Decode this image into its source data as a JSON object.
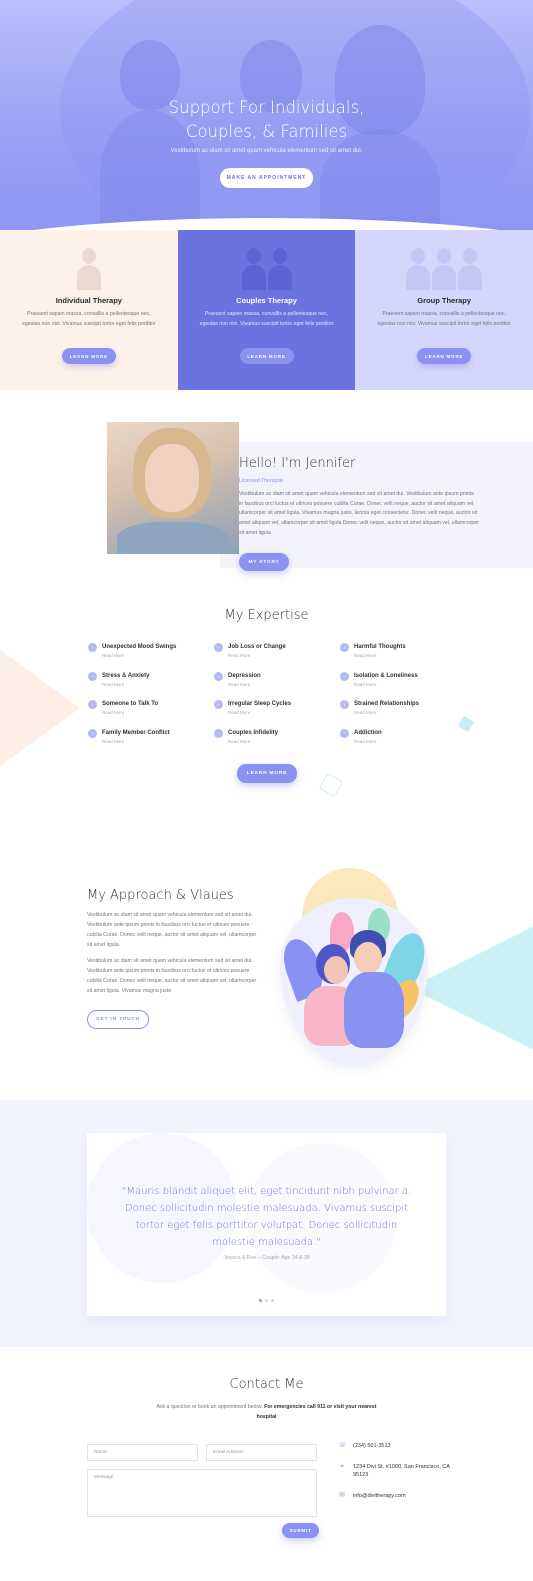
{
  "hero": {
    "title_line1": "Support For Individuals,",
    "title_line2": "Couples, & Families",
    "subtitle": "Vestibulum ac diam sit amet quam vehicula elementum sed sit amet dui.",
    "button": "MAKE AN APPOINTMENT"
  },
  "services": [
    {
      "title": "Individual Therapy",
      "text": "Praesent sapien massa, convallis a pellentesque nec, egestas non nisi. Vivamus suscipit tortor eget felis porttitor",
      "button": "LEARN MORE"
    },
    {
      "title": "Couples Therapy",
      "text": "Praesent sapien massa, convallis a pellentesque nec, egestas non nisi. Vivamus suscipit tortor eget felis porttitor",
      "button": "LEARN MORE"
    },
    {
      "title": "Group Therapy",
      "text": "Praesent sapien massa, convallis a pellentesque nec, egestas non nisi. Vivamus suscipit tortor eget felis porttitor",
      "button": "LEARN MORE"
    }
  ],
  "about": {
    "title": "Hello! I'm Jennifer",
    "role": "Licensed Therapist",
    "bio": "Vestibulum ac diam sit amet quam vehicula elementum sed sit amet dui. Vestibulum ante ipsum primis in faucibus orci luctus et ultrices posuere cubilia Curae. Donec velit neque, auctor sit amet aliquam vel, ullamcorper sit amet ligula. Vivamus magna justo, lacinia eget consectetur. Donec velit neque, auctor sit amet aliquam vel, ullamcorper sit amet ligula Donec velit neque, auctor sit amet aliquam vel, ullamcorper sit amet ligula",
    "button": "MY STORY"
  },
  "expertise": {
    "title": "My Expertise",
    "read_more": "Read More",
    "items": [
      {
        "num": "1",
        "label": "Unexpected Mood Swings"
      },
      {
        "num": "5",
        "label": "Job Loss or Change"
      },
      {
        "num": "9",
        "label": "Harmful Thoughts"
      },
      {
        "num": "2",
        "label": "Stress & Anxiety"
      },
      {
        "num": "6",
        "label": "Depression"
      },
      {
        "num": "10",
        "label": "Isolation & Loneliness"
      },
      {
        "num": "3",
        "label": "Someone to Talk To"
      },
      {
        "num": "7",
        "label": "Irregular Sleep Cycles"
      },
      {
        "num": "11",
        "label": "Strained Relationships"
      },
      {
        "num": "4",
        "label": "Family Member Conflict"
      },
      {
        "num": "8",
        "label": "Couples Infidelity"
      },
      {
        "num": "12",
        "label": "Addiction"
      }
    ],
    "button": "LEARN MORE"
  },
  "approach": {
    "title": "My Approach & Vlaues",
    "p1": "Vestibulum ac diam sit amet quam vehicula elementum sed sit amet dui. Vestibulum ante ipsum primis in faucibus orci luctus et ultrices posuere cubilia Curae. Donec velit neque, auctor sit amet aliquam vel, ullamcorper sit amet ligula.",
    "p2": "Vestibulum ac diam sit amet quam vehicula elementum sed sit amet dui. Vestibulum ante ipsum primis in faucibus orci luctus et ultrices posuere cubilia Curae. Donec velit neque, auctor sit amet aliquam vel, ullamcorper sit amet ligula. Vivamus magna justo",
    "button": "GET IN TOUCH"
  },
  "testimonial": {
    "quote": "\"Mauris blandit aliquet elit, eget tincidunt nibh pulvinar a. Donec sollicitudin molestie malesuada. Vivamus suscipit tortor eget felis porttitor volutpat. Donec sollicitudin molestie malesuada.\"",
    "author": "Jessica & Ron – Couple: Age 34 & 38"
  },
  "contact": {
    "title": "Contact Me",
    "intro_plain": "Ask a question or book an appointment below.",
    "intro_bold": "For emergencies call 911 or visit your nearest hospital",
    "name_placeholder": "Name",
    "email_placeholder": "Email Address",
    "message_placeholder": "Message",
    "submit": "SUBMIT",
    "phone": "(234) 501-3513",
    "address": "1234 Divi St. #1000, San Francisco, CA 95123",
    "email": "info@divitherapy.com"
  },
  "colors": {
    "accent": "#8a92f1",
    "primary": "#6b73e0",
    "peach": "#fdf1ea",
    "lavender": "#d4d6fb"
  },
  "icons": {
    "phone": "phone-icon",
    "location": "location-pin-icon",
    "email": "envelope-icon"
  }
}
